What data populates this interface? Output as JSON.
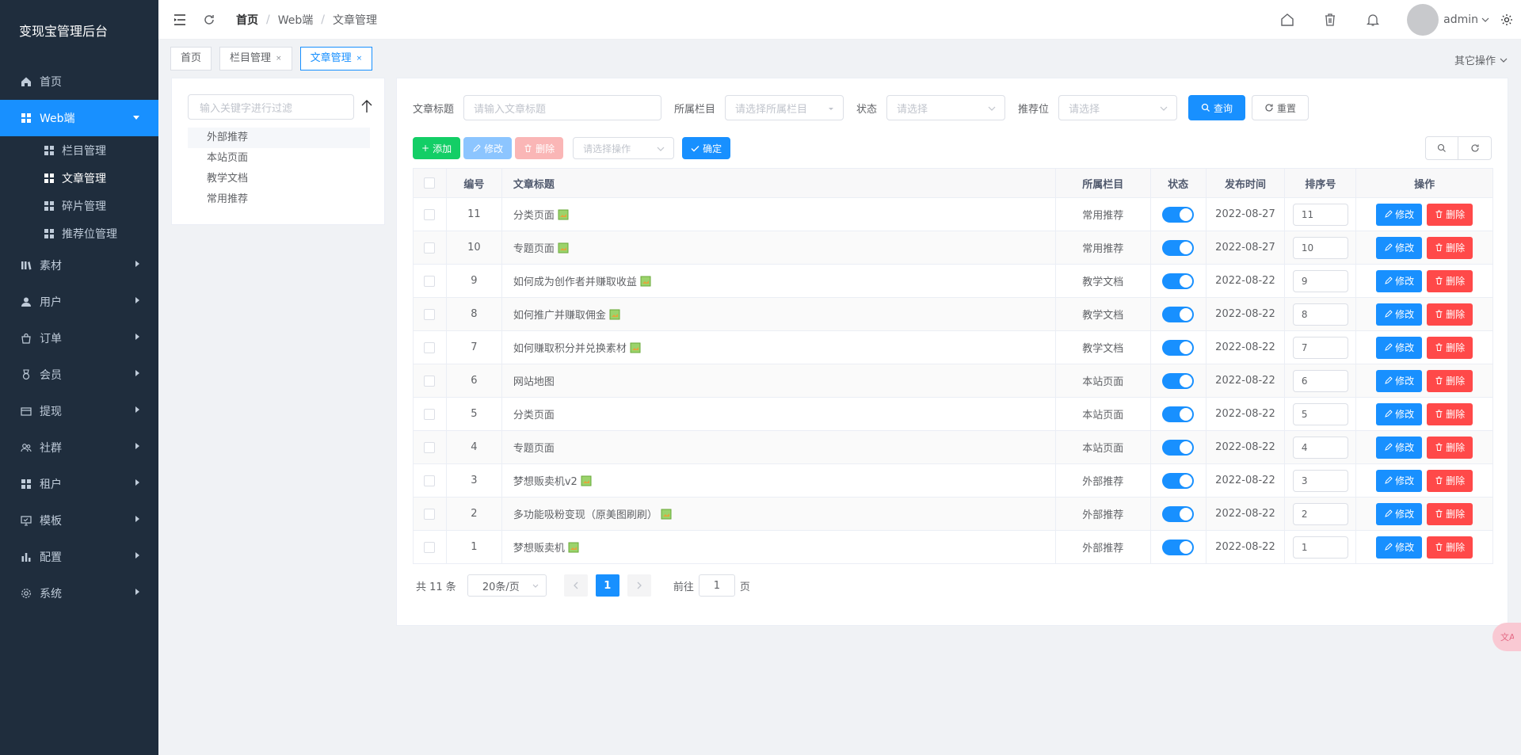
{
  "sidebar": {
    "brand": "变现宝管理后台",
    "items": [
      {
        "label": "首页",
        "icon": "home-icon"
      },
      {
        "label": "Web端",
        "icon": "grid-icon",
        "expanded": true
      },
      {
        "label": "素材",
        "icon": "library-icon"
      },
      {
        "label": "用户",
        "icon": "user-icon"
      },
      {
        "label": "订单",
        "icon": "bag-icon"
      },
      {
        "label": "会员",
        "icon": "medal-icon"
      },
      {
        "label": "提现",
        "icon": "wallet-icon"
      },
      {
        "label": "社群",
        "icon": "group-icon"
      },
      {
        "label": "租户",
        "icon": "grid-icon"
      },
      {
        "label": "模板",
        "icon": "template-icon"
      },
      {
        "label": "配置",
        "icon": "bar-chart-icon"
      },
      {
        "label": "系统",
        "icon": "gear-icon"
      }
    ],
    "submenu": [
      "栏目管理",
      "文章管理",
      "碎片管理",
      "推荐位管理"
    ]
  },
  "header": {
    "breadcrumb": [
      "首页",
      "Web端",
      "文章管理"
    ],
    "username": "admin"
  },
  "tags": [
    "首页",
    "栏目管理",
    "文章管理"
  ],
  "other_ops": "其它操作",
  "tree": {
    "filter_placeholder": "输入关键字进行过滤",
    "nodes": [
      "外部推荐",
      "本站页面",
      "教学文档",
      "常用推荐"
    ]
  },
  "filters": {
    "title_label": "文章标题",
    "title_placeholder": "请输入文章标题",
    "column_label": "所属栏目",
    "column_placeholder": "请选择所属栏目",
    "status_label": "状态",
    "status_placeholder": "请选择",
    "position_label": "推荐位",
    "position_placeholder": "请选择",
    "query": "查询",
    "reset": "重置"
  },
  "toolbar": {
    "add": "添加",
    "edit": "修改",
    "delete": "删除",
    "select_placeholder": "请选择操作",
    "confirm": "确定"
  },
  "table": {
    "headers": [
      "编号",
      "文章标题",
      "所属栏目",
      "状态",
      "发布时间",
      "排序号",
      "操作"
    ],
    "edit_label": "修改",
    "delete_label": "删除",
    "rows": [
      {
        "id": "11",
        "title": "分类页面",
        "icon": true,
        "column": "常用推荐",
        "date": "2022-08-27",
        "sort": "11"
      },
      {
        "id": "10",
        "title": "专题页面",
        "icon": true,
        "column": "常用推荐",
        "date": "2022-08-27",
        "sort": "10"
      },
      {
        "id": "9",
        "title": "如何成为创作者并赚取收益",
        "icon": true,
        "column": "教学文档",
        "date": "2022-08-22",
        "sort": "9"
      },
      {
        "id": "8",
        "title": "如何推广并赚取佣金",
        "icon": true,
        "column": "教学文档",
        "date": "2022-08-22",
        "sort": "8"
      },
      {
        "id": "7",
        "title": "如何赚取积分并兑换素材",
        "icon": true,
        "column": "教学文档",
        "date": "2022-08-22",
        "sort": "7"
      },
      {
        "id": "6",
        "title": "网站地图",
        "icon": false,
        "column": "本站页面",
        "date": "2022-08-22",
        "sort": "6"
      },
      {
        "id": "5",
        "title": "分类页面",
        "icon": false,
        "column": "本站页面",
        "date": "2022-08-22",
        "sort": "5"
      },
      {
        "id": "4",
        "title": "专题页面",
        "icon": false,
        "column": "本站页面",
        "date": "2022-08-22",
        "sort": "4"
      },
      {
        "id": "3",
        "title": "梦想贩卖机v2",
        "icon": true,
        "column": "外部推荐",
        "date": "2022-08-22",
        "sort": "3"
      },
      {
        "id": "2",
        "title": "多功能吸粉变现（原美图刷刷）",
        "icon": true,
        "column": "外部推荐",
        "date": "2022-08-22",
        "sort": "2"
      },
      {
        "id": "1",
        "title": "梦想贩卖机",
        "icon": true,
        "column": "外部推荐",
        "date": "2022-08-22",
        "sort": "1"
      }
    ]
  },
  "pagination": {
    "total": "共 11 条",
    "page_size": "20条/页",
    "current": "1",
    "goto_prefix": "前往",
    "goto_value": "1",
    "goto_suffix": "页"
  },
  "colors": {
    "primary": "#1890ff",
    "danger": "#ff4949",
    "success": "#13ce66",
    "sidebar": "#1f2d3d"
  }
}
